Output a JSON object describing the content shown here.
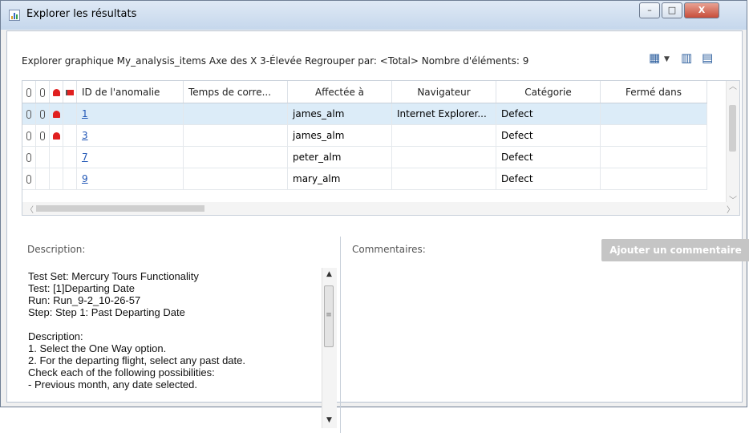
{
  "window": {
    "title": "Explorer les résultats",
    "controls": {
      "minimize": "–",
      "maximize": "□",
      "close": "X"
    }
  },
  "header": {
    "summary": "Explorer graphique My_analysis_items Axe des X 3-Élevée Regrouper par: <Total> Nombre d'éléments: 9"
  },
  "toolbar": {
    "icons": [
      "export-to-excel-icon",
      "dropdown-arrow-icon",
      "select-columns-icon",
      "details-icon"
    ]
  },
  "grid": {
    "columns": [
      "ID de l'anomalie",
      "Temps de corre...",
      "Affectée à",
      "Navigateur",
      "Catégorie",
      "Fermé dans"
    ],
    "rows": [
      {
        "id": "1",
        "time": "",
        "assigned": "james_alm",
        "browser": "Internet Explorer...",
        "category": "Defect",
        "closed": "",
        "att": true,
        "att2": true,
        "bell": true,
        "selected": true
      },
      {
        "id": "3",
        "time": "",
        "assigned": "james_alm",
        "browser": "",
        "category": "Defect",
        "closed": "",
        "att": true,
        "att2": true,
        "bell": true,
        "selected": false
      },
      {
        "id": "7",
        "time": "",
        "assigned": "peter_alm",
        "browser": "",
        "category": "Defect",
        "closed": "",
        "att": true,
        "att2": false,
        "bell": false,
        "selected": false
      },
      {
        "id": "9",
        "time": "",
        "assigned": "mary_alm",
        "browser": "",
        "category": "Defect",
        "closed": "",
        "att": true,
        "att2": false,
        "bell": false,
        "selected": false
      }
    ]
  },
  "description": {
    "label": "Description:",
    "lines": [
      "Test Set: Mercury Tours Functionality",
      "Test: [1]Departing Date",
      "Run: Run_9-2_10-26-57",
      "Step: Step 1: Past Departing Date",
      "",
      "Description:",
      "1. Select the One Way option.",
      "2. For the departing flight, select any past date.",
      "Check each of the following possibilities:",
      "- Previous month, any date selected."
    ]
  },
  "comments": {
    "label": "Commentaires:",
    "add_button": "Ajouter un commentaire"
  }
}
